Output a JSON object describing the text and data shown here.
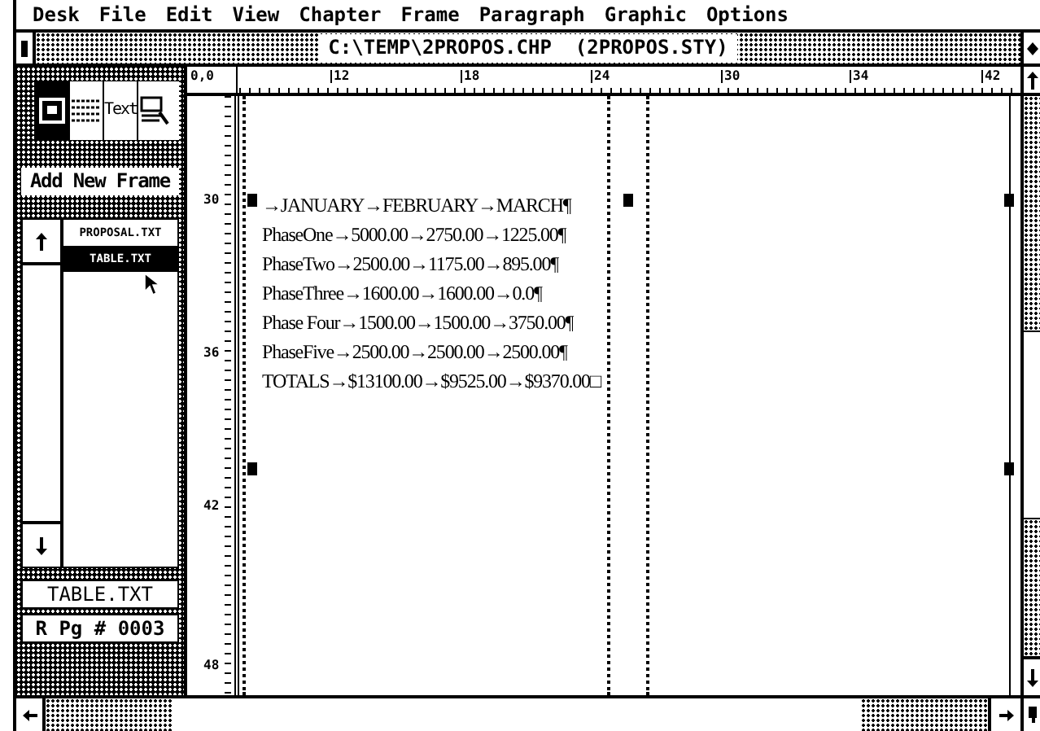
{
  "menu_bar": [
    "Desk",
    "File",
    "Edit",
    "View",
    "Chapter",
    "Frame",
    "Paragraph",
    "Graphic",
    "Options"
  ],
  "window": {
    "title": "C:\\TEMP\\2PROPOS.CHP  (2PROPOS.STY)"
  },
  "horizontal_ruler": [
    "0,0",
    "12",
    "18",
    "24",
    "30",
    "34",
    "42"
  ],
  "vertical_ruler": [
    "30",
    "36",
    "42",
    "48"
  ],
  "modes": [
    {
      "kind": "frame",
      "selected": true
    },
    {
      "kind": "paragraph",
      "selected": false
    },
    {
      "kind": "text",
      "label": "Text",
      "selected": false
    },
    {
      "kind": "graphic",
      "selected": false
    }
  ],
  "add_button": "Add New Frame",
  "files": [
    {
      "name": "PROPOSAL.TXT",
      "selected": false
    },
    {
      "name": "TABLE.TXT",
      "selected": true
    }
  ],
  "current_file": "TABLE.TXT",
  "page_indicator": "R Pg # 0003",
  "document_lines": [
    "→JANUARY→FEBRUARY→MARCH¶",
    "PhaseOne→5000.00→2750.00→1225.00¶",
    "PhaseTwo→2500.00→1175.00→895.00¶",
    "PhaseThree→1600.00→1600.00→0.0¶",
    "Phase Four→1500.00→1500.00→3750.00¶",
    "PhaseFive→2500.00→2500.00→2500.00¶",
    "TOTALS→$13100.00→$9525.00→$9370.00□"
  ]
}
